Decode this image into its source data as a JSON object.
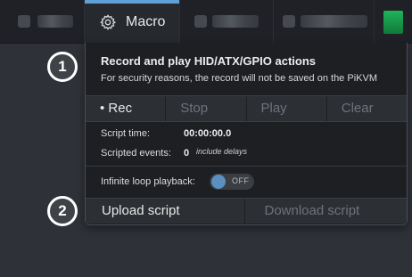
{
  "navbar": {
    "macro_label": "Macro",
    "accent_color": "#5fa1d6"
  },
  "menu": {
    "title": "Record and play HID/ATX/GPIO actions",
    "subtitle": "For security reasons, the record will not be saved on the PiKVM",
    "controls": {
      "rec": "• Rec",
      "stop": "Stop",
      "play": "Play",
      "clear": "Clear"
    },
    "script_time_label": "Script time:",
    "script_time_value": "00:00:00.0",
    "scripted_events_label": "Scripted events:",
    "scripted_events_value": "0",
    "delays_note": "include delays",
    "loop_label": "Infinite loop playback:",
    "loop_state": "OFF",
    "upload_label": "Upload script",
    "download_label": "Download script"
  },
  "callouts": {
    "one": "1",
    "two": "2"
  }
}
